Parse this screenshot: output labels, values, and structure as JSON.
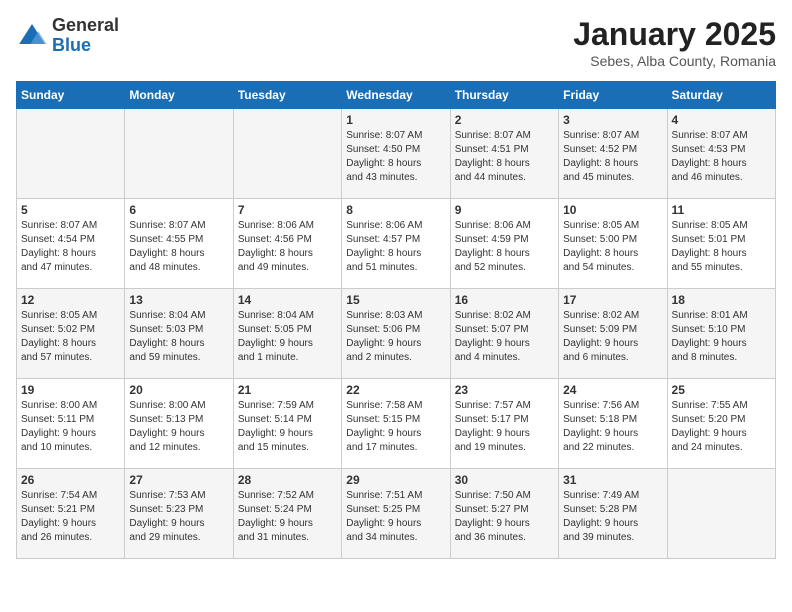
{
  "header": {
    "logo_general": "General",
    "logo_blue": "Blue",
    "title": "January 2025",
    "subtitle": "Sebes, Alba County, Romania"
  },
  "days_of_week": [
    "Sunday",
    "Monday",
    "Tuesday",
    "Wednesday",
    "Thursday",
    "Friday",
    "Saturday"
  ],
  "weeks": [
    [
      {
        "day": "",
        "info": ""
      },
      {
        "day": "",
        "info": ""
      },
      {
        "day": "",
        "info": ""
      },
      {
        "day": "1",
        "info": "Sunrise: 8:07 AM\nSunset: 4:50 PM\nDaylight: 8 hours\nand 43 minutes."
      },
      {
        "day": "2",
        "info": "Sunrise: 8:07 AM\nSunset: 4:51 PM\nDaylight: 8 hours\nand 44 minutes."
      },
      {
        "day": "3",
        "info": "Sunrise: 8:07 AM\nSunset: 4:52 PM\nDaylight: 8 hours\nand 45 minutes."
      },
      {
        "day": "4",
        "info": "Sunrise: 8:07 AM\nSunset: 4:53 PM\nDaylight: 8 hours\nand 46 minutes."
      }
    ],
    [
      {
        "day": "5",
        "info": "Sunrise: 8:07 AM\nSunset: 4:54 PM\nDaylight: 8 hours\nand 47 minutes."
      },
      {
        "day": "6",
        "info": "Sunrise: 8:07 AM\nSunset: 4:55 PM\nDaylight: 8 hours\nand 48 minutes."
      },
      {
        "day": "7",
        "info": "Sunrise: 8:06 AM\nSunset: 4:56 PM\nDaylight: 8 hours\nand 49 minutes."
      },
      {
        "day": "8",
        "info": "Sunrise: 8:06 AM\nSunset: 4:57 PM\nDaylight: 8 hours\nand 51 minutes."
      },
      {
        "day": "9",
        "info": "Sunrise: 8:06 AM\nSunset: 4:59 PM\nDaylight: 8 hours\nand 52 minutes."
      },
      {
        "day": "10",
        "info": "Sunrise: 8:05 AM\nSunset: 5:00 PM\nDaylight: 8 hours\nand 54 minutes."
      },
      {
        "day": "11",
        "info": "Sunrise: 8:05 AM\nSunset: 5:01 PM\nDaylight: 8 hours\nand 55 minutes."
      }
    ],
    [
      {
        "day": "12",
        "info": "Sunrise: 8:05 AM\nSunset: 5:02 PM\nDaylight: 8 hours\nand 57 minutes."
      },
      {
        "day": "13",
        "info": "Sunrise: 8:04 AM\nSunset: 5:03 PM\nDaylight: 8 hours\nand 59 minutes."
      },
      {
        "day": "14",
        "info": "Sunrise: 8:04 AM\nSunset: 5:05 PM\nDaylight: 9 hours\nand 1 minute."
      },
      {
        "day": "15",
        "info": "Sunrise: 8:03 AM\nSunset: 5:06 PM\nDaylight: 9 hours\nand 2 minutes."
      },
      {
        "day": "16",
        "info": "Sunrise: 8:02 AM\nSunset: 5:07 PM\nDaylight: 9 hours\nand 4 minutes."
      },
      {
        "day": "17",
        "info": "Sunrise: 8:02 AM\nSunset: 5:09 PM\nDaylight: 9 hours\nand 6 minutes."
      },
      {
        "day": "18",
        "info": "Sunrise: 8:01 AM\nSunset: 5:10 PM\nDaylight: 9 hours\nand 8 minutes."
      }
    ],
    [
      {
        "day": "19",
        "info": "Sunrise: 8:00 AM\nSunset: 5:11 PM\nDaylight: 9 hours\nand 10 minutes."
      },
      {
        "day": "20",
        "info": "Sunrise: 8:00 AM\nSunset: 5:13 PM\nDaylight: 9 hours\nand 12 minutes."
      },
      {
        "day": "21",
        "info": "Sunrise: 7:59 AM\nSunset: 5:14 PM\nDaylight: 9 hours\nand 15 minutes."
      },
      {
        "day": "22",
        "info": "Sunrise: 7:58 AM\nSunset: 5:15 PM\nDaylight: 9 hours\nand 17 minutes."
      },
      {
        "day": "23",
        "info": "Sunrise: 7:57 AM\nSunset: 5:17 PM\nDaylight: 9 hours\nand 19 minutes."
      },
      {
        "day": "24",
        "info": "Sunrise: 7:56 AM\nSunset: 5:18 PM\nDaylight: 9 hours\nand 22 minutes."
      },
      {
        "day": "25",
        "info": "Sunrise: 7:55 AM\nSunset: 5:20 PM\nDaylight: 9 hours\nand 24 minutes."
      }
    ],
    [
      {
        "day": "26",
        "info": "Sunrise: 7:54 AM\nSunset: 5:21 PM\nDaylight: 9 hours\nand 26 minutes."
      },
      {
        "day": "27",
        "info": "Sunrise: 7:53 AM\nSunset: 5:23 PM\nDaylight: 9 hours\nand 29 minutes."
      },
      {
        "day": "28",
        "info": "Sunrise: 7:52 AM\nSunset: 5:24 PM\nDaylight: 9 hours\nand 31 minutes."
      },
      {
        "day": "29",
        "info": "Sunrise: 7:51 AM\nSunset: 5:25 PM\nDaylight: 9 hours\nand 34 minutes."
      },
      {
        "day": "30",
        "info": "Sunrise: 7:50 AM\nSunset: 5:27 PM\nDaylight: 9 hours\nand 36 minutes."
      },
      {
        "day": "31",
        "info": "Sunrise: 7:49 AM\nSunset: 5:28 PM\nDaylight: 9 hours\nand 39 minutes."
      },
      {
        "day": "",
        "info": ""
      }
    ]
  ]
}
